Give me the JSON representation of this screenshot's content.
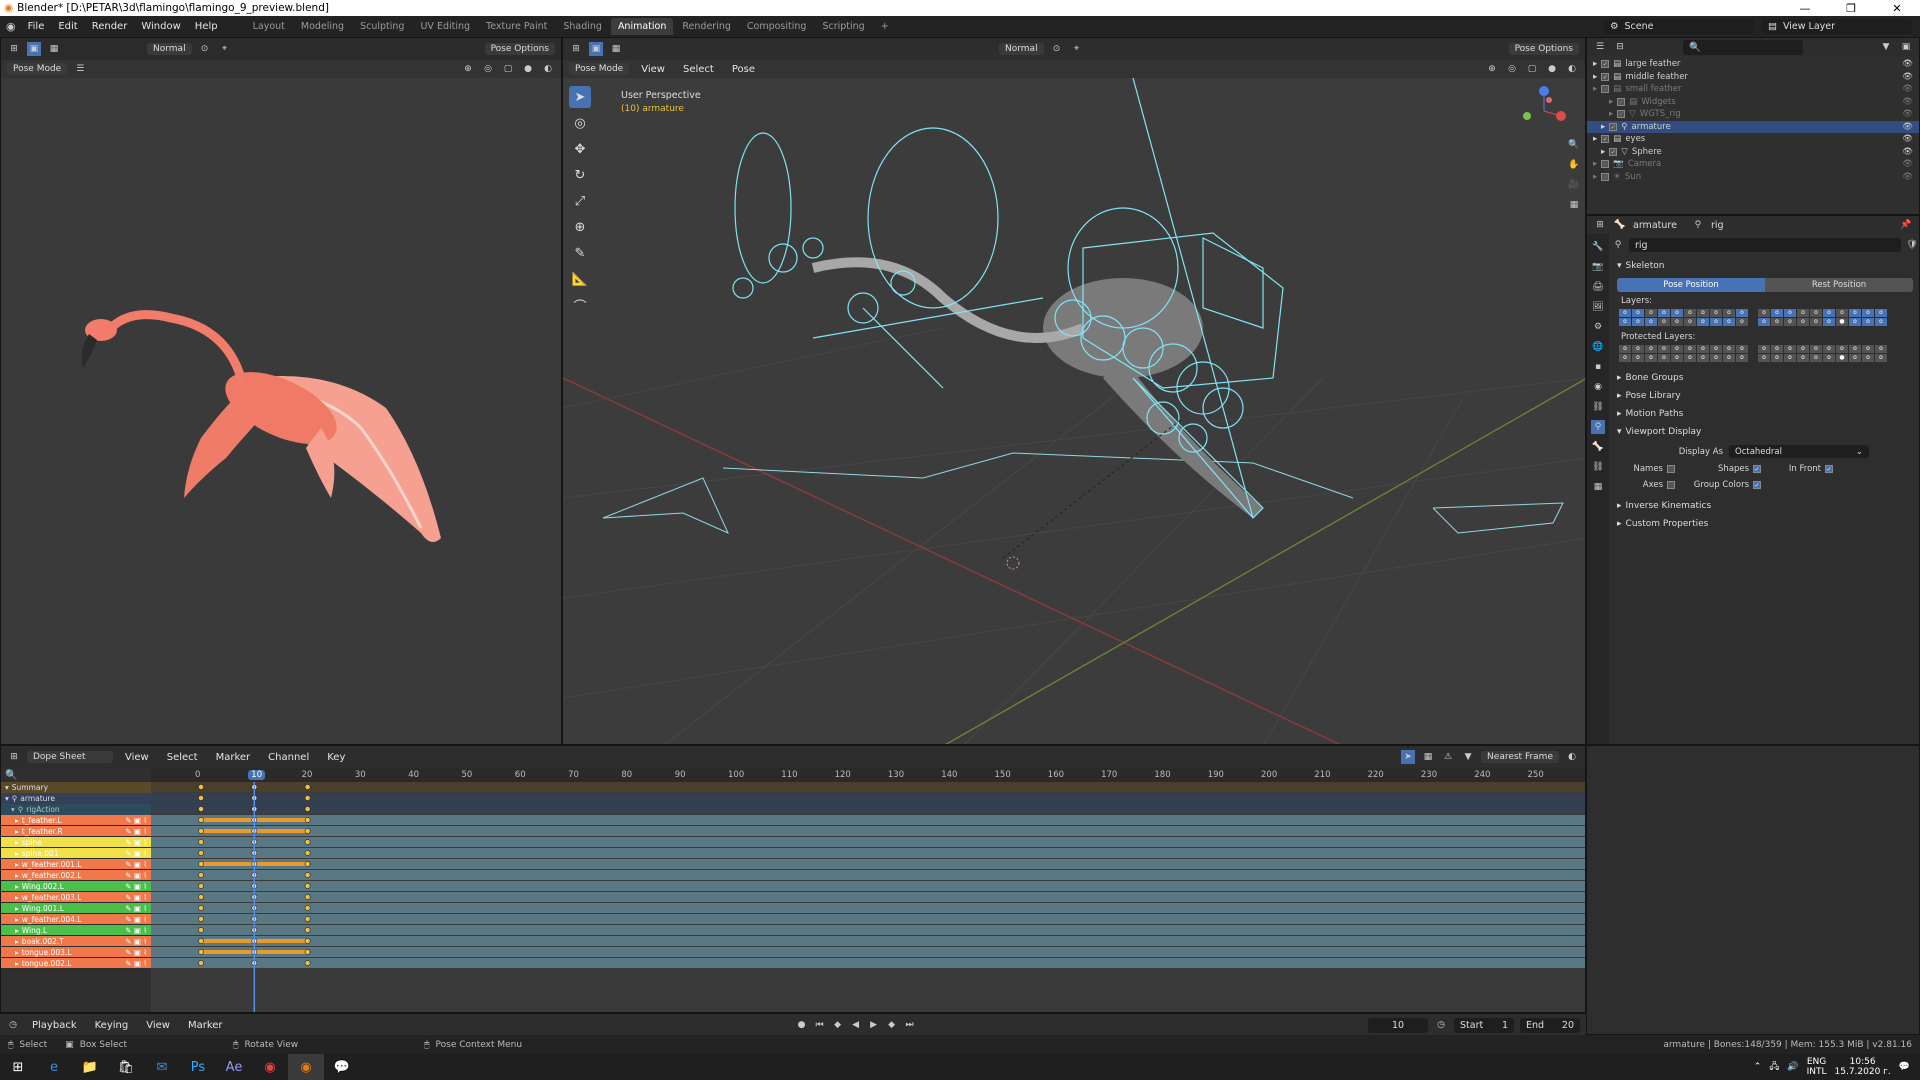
{
  "window": {
    "title": "Blender* [D:\\PETAR\\3d\\flamingo\\flamingo_9_preview.blend]"
  },
  "menu": [
    "File",
    "Edit",
    "Render",
    "Window",
    "Help"
  ],
  "workspaces": [
    "Layout",
    "Modeling",
    "Sculpting",
    "UV Editing",
    "Texture Paint",
    "Shading",
    "Animation",
    "Rendering",
    "Compositing",
    "Scripting"
  ],
  "active_workspace": "Animation",
  "scene": {
    "scene_label": "Scene",
    "view_layer_label": "View Layer"
  },
  "left_viewport": {
    "mode": "Pose Mode",
    "transform": "Normal",
    "pose_options": "Pose Options"
  },
  "main_viewport": {
    "mode": "Pose Mode",
    "menus": [
      "View",
      "Select",
      "Pose"
    ],
    "transform": "Normal",
    "pose_options": "Pose Options",
    "overlay_title": "User Perspective",
    "overlay_subtitle": "(10) armature"
  },
  "outliner": {
    "rows": [
      {
        "name": "large feather",
        "icon": "collection",
        "selected": false,
        "dim": false
      },
      {
        "name": "middle feather",
        "icon": "collection",
        "selected": false,
        "dim": false
      },
      {
        "name": "small feather",
        "icon": "collection",
        "selected": false,
        "dim": true
      },
      {
        "name": "Widgets",
        "icon": "collection",
        "selected": false,
        "dim": true
      },
      {
        "name": "WGTS_rig",
        "icon": "mesh",
        "selected": false,
        "dim": true
      },
      {
        "name": "armature",
        "icon": "armature",
        "selected": true,
        "dim": false
      },
      {
        "name": "eyes",
        "icon": "collection",
        "selected": false,
        "dim": false
      },
      {
        "name": "Sphere",
        "icon": "mesh",
        "selected": false,
        "dim": false
      },
      {
        "name": "Camera",
        "icon": "camera",
        "selected": false,
        "dim": true
      },
      {
        "name": "Sun",
        "icon": "light",
        "selected": false,
        "dim": true
      }
    ]
  },
  "properties": {
    "breadcrumb_object": "armature",
    "breadcrumb_data": "rig",
    "data_name": "rig",
    "skeleton_label": "Skeleton",
    "pose_position": "Pose Position",
    "rest_position": "Rest Position",
    "layers_label": "Layers:",
    "protected_layers_label": "Protected Layers:",
    "collapsed_sections": [
      "Bone Groups",
      "Pose Library",
      "Motion Paths"
    ],
    "viewport_display_label": "Viewport Display",
    "display_as_label": "Display As",
    "display_as_value": "Octahedral",
    "names_label": "Names",
    "shapes_label": "Shapes",
    "in_front_label": "In Front",
    "axes_label": "Axes",
    "group_colors_label": "Group Colors",
    "bottom_sections": [
      "Inverse Kinematics",
      "Custom Properties"
    ]
  },
  "dopesheet": {
    "editor": "Dope Sheet",
    "menus": [
      "View",
      "Select",
      "Marker",
      "Channel",
      "Key"
    ],
    "snap": "Nearest Frame",
    "ruler": [
      "0",
      "10",
      "20",
      "30",
      "40",
      "50",
      "60",
      "70",
      "80",
      "90",
      "100",
      "110",
      "120",
      "130",
      "140",
      "150",
      "160",
      "170",
      "180",
      "190",
      "200",
      "210",
      "220",
      "230",
      "240",
      "250"
    ],
    "current_frame_label": "10",
    "summary_label": "Summary",
    "object_label": "armature",
    "action_label": "rigAction",
    "channels": [
      {
        "name": "t_feather.L",
        "color": "#f0784a",
        "hold": true
      },
      {
        "name": "t_feather.R",
        "color": "#f0784a",
        "hold": true
      },
      {
        "name": "spine",
        "color": "#f0e04a",
        "hold": false
      },
      {
        "name": "spine.001",
        "color": "#f0e04a",
        "hold": false
      },
      {
        "name": "w_feather.001.L",
        "color": "#f0784a",
        "hold": true
      },
      {
        "name": "w_feather.002.L",
        "color": "#f0784a",
        "hold": false
      },
      {
        "name": "Wing.002.L",
        "color": "#4ac04a",
        "hold": false
      },
      {
        "name": "w_feather.003.L",
        "color": "#f0784a",
        "hold": false
      },
      {
        "name": "Wing.001.L",
        "color": "#4ac04a",
        "hold": false
      },
      {
        "name": "w_feather.004.L",
        "color": "#f0784a",
        "hold": false
      },
      {
        "name": "Wing.L",
        "color": "#4ac04a",
        "hold": false
      },
      {
        "name": "beak.002.T",
        "color": "#f0784a",
        "hold": true
      },
      {
        "name": "tongue.003.L",
        "color": "#f0784a",
        "hold": true
      },
      {
        "name": "tongue.002.L",
        "color": "#f0784a",
        "hold": false
      }
    ]
  },
  "timeline": {
    "menus": [
      "Playback",
      "Keying",
      "View",
      "Marker"
    ],
    "current_frame": "10",
    "start_label": "Start",
    "start_value": "1",
    "end_label": "End",
    "end_value": "20"
  },
  "statusbar": {
    "select": "Select",
    "box_select": "Box Select",
    "rotate_view": "Rotate View",
    "context_menu": "Pose Context Menu",
    "stats": "armature | Bones:148/359 | Mem: 155.3 MiB | v2.81.16"
  },
  "taskbar": {
    "lang1": "ENG",
    "lang2": "INTL",
    "time": "10:56",
    "date": "15.7.2020 г."
  }
}
